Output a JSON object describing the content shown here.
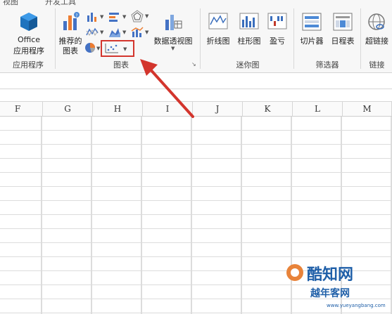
{
  "tabs": [
    "视图",
    "开发工具"
  ],
  "ribbon": {
    "apps": {
      "office_line1": "Office",
      "office_line2": "应用程序",
      "group_label": "应用程序"
    },
    "charts": {
      "recommended_line1": "推荐的",
      "recommended_line2": "图表",
      "pivot_chart": "数据透视图",
      "group_label": "图表"
    },
    "sparklines": {
      "line": "折线图",
      "column": "柱形图",
      "winloss": "盈亏",
      "group_label": "迷你图"
    },
    "filters": {
      "slicer": "切片器",
      "timeline": "日程表",
      "group_label": "筛选器"
    },
    "links": {
      "hyperlink": "超链接",
      "group_label": "链接"
    }
  },
  "columns": [
    "F",
    "G",
    "H",
    "I",
    "J",
    "K",
    "L",
    "M"
  ],
  "watermark": {
    "title": "酷知网",
    "subtitle": "越年客网",
    "url": "www.yueyangbang.com"
  },
  "colors": {
    "highlight": "#d3352d",
    "office_blue": "#1e73be",
    "grid": "#dcdcdc"
  },
  "icons": [
    "office-apps-icon",
    "recommended-charts-icon",
    "column-chart-icon",
    "bar-chart-icon",
    "radar-chart-icon",
    "line-chart-icon",
    "area-chart-icon",
    "combo-chart-icon",
    "pie-chart-icon",
    "scatter-chart-icon",
    "pivot-chart-icon",
    "sparkline-line-icon",
    "sparkline-column-icon",
    "sparkline-winloss-icon",
    "slicer-icon",
    "timeline-icon",
    "hyperlink-icon"
  ]
}
